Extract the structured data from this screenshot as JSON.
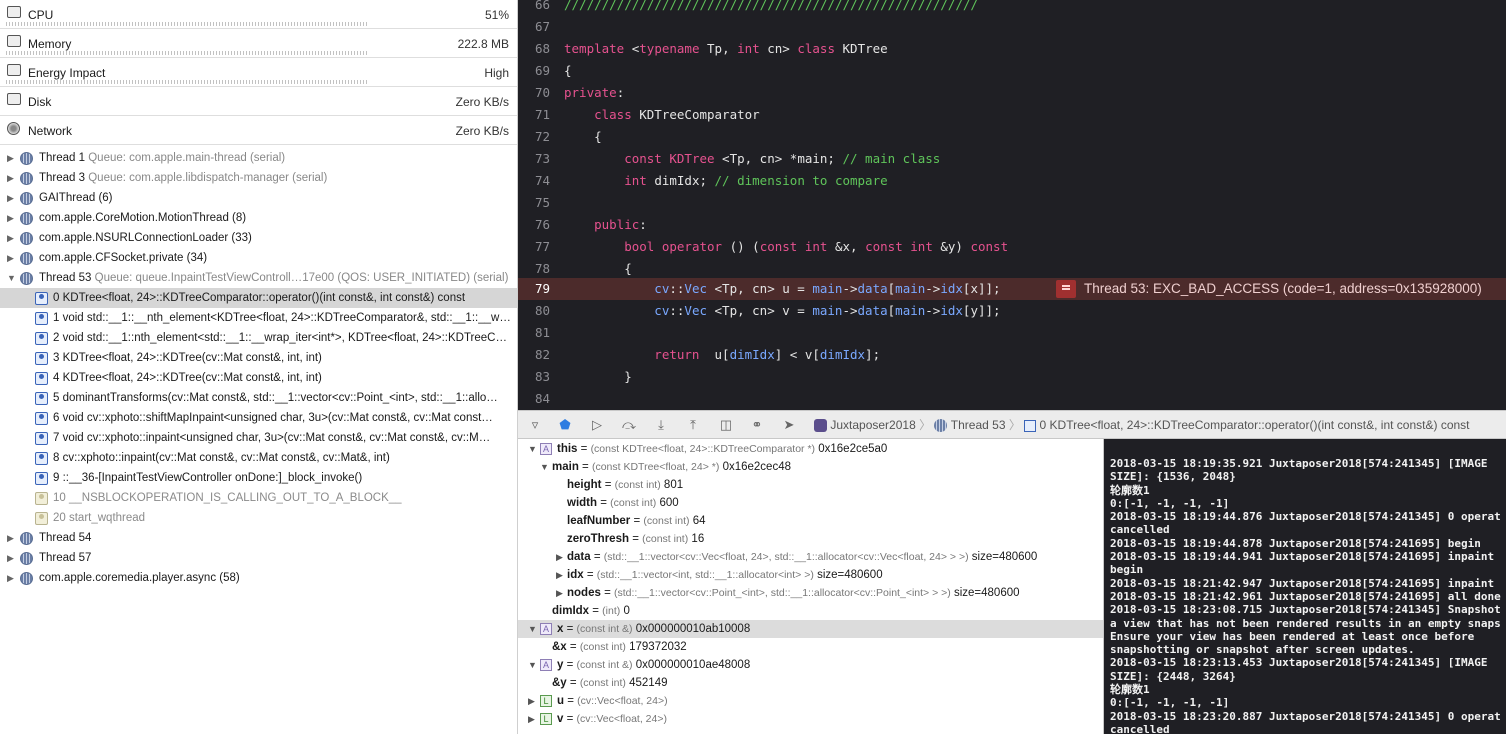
{
  "gauges": [
    {
      "icon": "cpu-gauge-icon",
      "label": "CPU",
      "value": "51%"
    },
    {
      "icon": "memory-gauge-icon",
      "label": "Memory",
      "value": "222.8 MB"
    },
    {
      "icon": "energy-gauge-icon",
      "label": "Energy Impact",
      "value": "High"
    },
    {
      "icon": "disk-gauge-icon",
      "label": "Disk",
      "value": "Zero KB/s"
    },
    {
      "icon": "network-gauge-icon",
      "label": "Network",
      "value": "Zero KB/s"
    }
  ],
  "threads_top": [
    {
      "name": "Thread 1",
      "queue": "Queue: com.apple.main-thread (serial)"
    },
    {
      "name": "Thread 3",
      "queue": "Queue: com.apple.libdispatch-manager (serial)"
    },
    {
      "name": "GAIThread (6)",
      "queue": ""
    },
    {
      "name": "com.apple.CoreMotion.MotionThread (8)",
      "queue": ""
    },
    {
      "name": "com.apple.NSURLConnectionLoader (33)",
      "queue": ""
    },
    {
      "name": "com.apple.CFSocket.private (34)",
      "queue": ""
    },
    {
      "name": "Thread 53",
      "queue": "Queue: queue.InpaintTestViewControll…17e00 (QOS: USER_INITIATED) (serial)"
    }
  ],
  "frames": [
    {
      "text": "0 KDTree<float, 24>::KDTreeComparator::operator()(int const&, int const&) const",
      "grey": false
    },
    {
      "text": "1 void std::__1::__nth_element<KDTree<float, 24>::KDTreeComparator&, std::__1::__wr…",
      "grey": false
    },
    {
      "text": "2 void std::__1::nth_element<std::__1::__wrap_iter<int*>, KDTree<float, 24>::KDTreeC…",
      "grey": false
    },
    {
      "text": "3 KDTree<float, 24>::KDTree(cv::Mat const&, int, int)",
      "grey": false
    },
    {
      "text": "4 KDTree<float, 24>::KDTree(cv::Mat const&, int, int)",
      "grey": false
    },
    {
      "text": "5 dominantTransforms(cv::Mat const&, std::__1::vector<cv::Point_<int>, std::__1::allo…",
      "grey": false
    },
    {
      "text": "6 void cv::xphoto::shiftMapInpaint<unsigned char, 3u>(cv::Mat const&, cv::Mat const…",
      "grey": false
    },
    {
      "text": "7 void cv::xphoto::inpaint<unsigned char, 3u>(cv::Mat const&, cv::Mat const&, cv::M…",
      "grey": false
    },
    {
      "text": "8 cv::xphoto::inpaint(cv::Mat const&, cv::Mat const&, cv::Mat&, int)",
      "grey": false
    },
    {
      "text": "9 ::__36-[InpaintTestViewController onDone:]_block_invoke()",
      "grey": false
    },
    {
      "text": "10 __NSBLOCKOPERATION_IS_CALLING_OUT_TO_A_BLOCK__",
      "grey": true
    },
    {
      "text": "20 start_wqthread",
      "grey": true
    }
  ],
  "threads_bottom": [
    {
      "name": "Thread 54"
    },
    {
      "name": "Thread 57"
    },
    {
      "name": "com.apple.coremedia.player.async (58)"
    }
  ],
  "code": {
    "l66": "66",
    "c66": "///////////////////////////////////////////////////////",
    "l67": "67",
    "l68": "68",
    "c68a": "template",
    "c68b": " <",
    "c68c": "typename",
    "c68d": " Tp, ",
    "c68e": "int",
    "c68f": " cn> ",
    "c68g": "class",
    "c68h": " KDTree",
    "l69": "69",
    "c69": "{",
    "l70": "70",
    "c70a": "private",
    "c70b": ":",
    "l71": "71",
    "c71a": "    class",
    "c71b": " KDTreeComparator",
    "l72": "72",
    "c72": "    {",
    "l73": "73",
    "c73a": "        const",
    "c73b": " KDTree",
    "c73c": " <Tp, cn> *main; ",
    "c73d": "// main class",
    "l74": "74",
    "c74a": "        int",
    "c74b": " dimIdx; ",
    "c74c": "// dimension to compare",
    "l75": "75",
    "l76": "76",
    "c76a": "    public",
    "c76b": ":",
    "l77": "77",
    "c77a": "        bool",
    "c77b": " ",
    "c77c": "operator",
    "c77d": " () (",
    "c77e": "const",
    "c77f": " ",
    "c77g": "int",
    "c77h": " &x, ",
    "c77i": "const",
    "c77j": " ",
    "c77k": "int",
    "c77l": " &y) ",
    "c77m": "const",
    "l78": "78",
    "c78": "        {",
    "l79": "79",
    "c79a": "            cv",
    "c79b": "::",
    "c79c": "Vec",
    "c79d": " <Tp, cn> u = ",
    "c79e": "main",
    "c79f": "->",
    "c79g": "data",
    "c79h": "[",
    "c79i": "main",
    "c79j": "->",
    "c79k": "idx",
    "c79l": "[x]];",
    "l80": "80",
    "c80a": "            cv",
    "c80b": "::",
    "c80c": "Vec",
    "c80d": " <Tp, cn> v = ",
    "c80e": "main",
    "c80f": "->",
    "c80g": "data",
    "c80h": "[",
    "c80i": "main",
    "c80j": "->",
    "c80k": "idx",
    "c80l": "[y]];",
    "l81": "81",
    "l82": "82",
    "c82a": "            return",
    "c82b": "  u[",
    "c82c": "dimIdx",
    "c82d": "] < v[",
    "c82e": "dimIdx",
    "c82f": "];",
    "l83": "83",
    "c83": "        }",
    "l84": "84",
    "error": "Thread 53: EXC_BAD_ACCESS (code=1, address=0x135928000)"
  },
  "debugbar": {
    "app": "Juxtaposer2018",
    "thread": "Thread 53",
    "frame": "0 KDTree<float, 24>::KDTreeComparator::operator()(int const&, int const&) const"
  },
  "vars": {
    "this_n": "this",
    "this_t": "(const KDTree<float, 24>::KDTreeComparator *)",
    "this_v": "0x16e2ce5a0",
    "main_n": "main",
    "main_t": "(const KDTree<float, 24> *)",
    "main_v": "0x16e2cec48",
    "height_n": "height",
    "height_t": "(const int)",
    "height_v": "801",
    "width_n": "width",
    "width_t": "(const int)",
    "width_v": "600",
    "leaf_n": "leafNumber",
    "leaf_t": "(const int)",
    "leaf_v": "64",
    "zero_n": "zeroThresh",
    "zero_t": "(const int)",
    "zero_v": "16",
    "data_n": "data",
    "data_t": "(std::__1::vector<cv::Vec<float, 24>, std::__1::allocator<cv::Vec<float, 24> > >)",
    "data_v": "size=480600",
    "idx_n": "idx",
    "idx_t": "(std::__1::vector<int, std::__1::allocator<int> >)",
    "idx_v": "size=480600",
    "nodes_n": "nodes",
    "nodes_t": "(std::__1::vector<cv::Point_<int>, std::__1::allocator<cv::Point_<int> > >)",
    "nodes_v": "size=480600",
    "dim_n": "dimIdx",
    "dim_t": "(int)",
    "dim_v": "0",
    "x_n": "x",
    "x_t": "(const int &)",
    "x_v": "0x000000010ab10008",
    "ax_n": "&x",
    "ax_t": "(const int)",
    "ax_v": "179372032",
    "y_n": "y",
    "y_t": "(const int &)",
    "y_v": "0x000000010ae48008",
    "ay_n": "&y",
    "ay_t": "(const int)",
    "ay_v": "452149",
    "u_n": "u",
    "u_t": "(cv::Vec<float, 24>)",
    "v_n": "v",
    "v_t": "(cv::Vec<float, 24>)",
    "badge_A": "A",
    "badge_L": "L"
  },
  "console": "2018-03-15 18:19:35.921 Juxtaposer2018[574:241345] [IMAGE\nSIZE]: {1536, 2048}\n轮廓数1\n0:[-1, -1, -1, -1]\n2018-03-15 18:19:44.876 Juxtaposer2018[574:241345] 0 operat\ncancelled\n2018-03-15 18:19:44.878 Juxtaposer2018[574:241695] begin\n2018-03-15 18:19:44.941 Juxtaposer2018[574:241695] inpaint\nbegin\n2018-03-15 18:21:42.947 Juxtaposer2018[574:241695] inpaint\n2018-03-15 18:21:42.961 Juxtaposer2018[574:241695] all done\n2018-03-15 18:23:08.715 Juxtaposer2018[574:241345] Snapshot\na view that has not been rendered results in an empty snaps\nEnsure your view has been rendered at least once before\nsnapshotting or snapshot after screen updates.\n2018-03-15 18:23:13.453 Juxtaposer2018[574:241345] [IMAGE\nSIZE]: {2448, 3264}\n轮廓数1\n0:[-1, -1, -1, -1]\n2018-03-15 18:23:20.887 Juxtaposer2018[574:241345] 0 operat\ncancelled"
}
